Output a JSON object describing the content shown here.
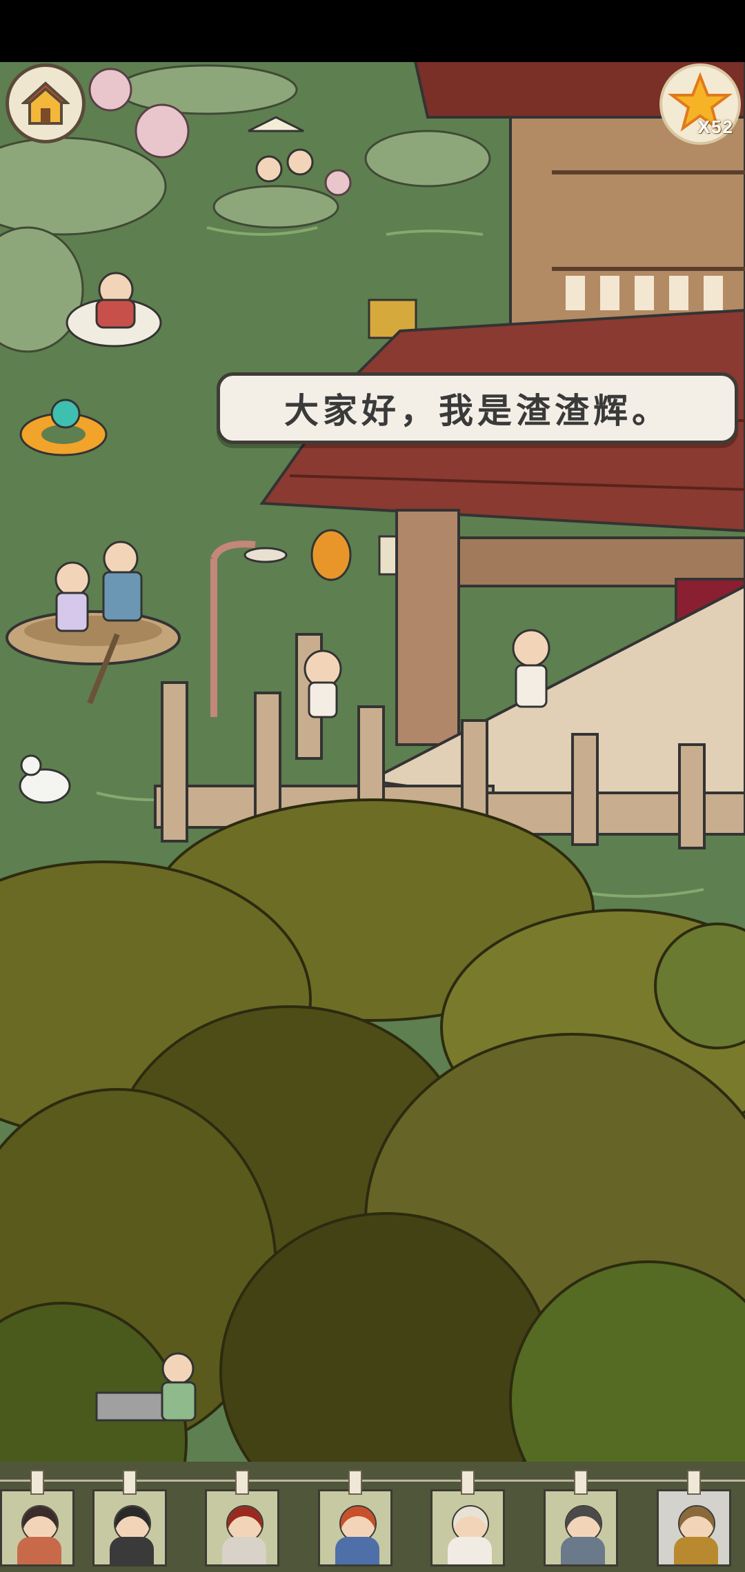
{
  "hud": {
    "home_icon": "house-icon",
    "star_icon": "star-icon",
    "star_count": "X52"
  },
  "dialog": {
    "text": "大家好，我是渣渣辉。"
  },
  "character_cards": [
    {
      "name": "character-card-1",
      "hair": "#3b2b2b",
      "cloth": "#c86a4a"
    },
    {
      "name": "character-card-2",
      "hair": "#2a2a2a",
      "cloth": "#3a3a3a"
    },
    {
      "name": "character-card-3",
      "hair": "#9a2a20",
      "cloth": "#d8d2c8"
    },
    {
      "name": "character-card-4",
      "hair": "#c8502a",
      "cloth": "#4f6fa8"
    },
    {
      "name": "character-card-5",
      "hair": "#e8e2d6",
      "cloth": "#f0ece4"
    },
    {
      "name": "character-card-6",
      "hair": "#4a4a4a",
      "cloth": "#6a7a8a"
    },
    {
      "name": "character-card-7",
      "hair": "#8a6a3a",
      "cloth": "#b8892e"
    }
  ],
  "colors": {
    "water": "#5e7f4f",
    "roof": "#7a2f27",
    "wood": "#a07a5a",
    "tree_dark": "#4b4a18",
    "tree_mid": "#6b6a24",
    "tree_light": "#8a8a35"
  }
}
